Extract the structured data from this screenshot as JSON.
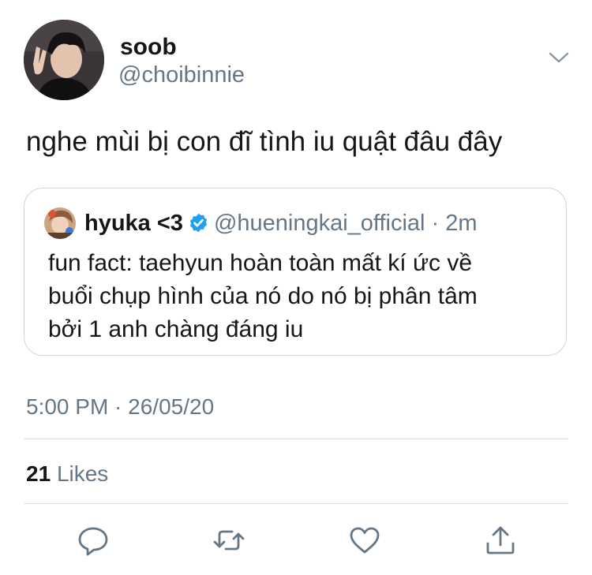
{
  "author": {
    "display_name": "soob",
    "handle": "@choibinnie"
  },
  "tweet": {
    "text": "nghe mùi bị con đĩ tình iu quật đâu đây",
    "timestamp": "5:00 PM · 26/05/20",
    "likes_count": "21",
    "likes_label": "Likes"
  },
  "quoted_tweet": {
    "display_name": "hyuka <3",
    "handle": "@hueningkai_official",
    "separator": " · ",
    "time": "2m",
    "lines": [
      "fun fact: taehyun hoàn toàn mất kí ức về",
      "buổi chụp hình của nó do nó bị phân tâm",
      "bởi 1 anh chàng đáng iu"
    ]
  },
  "icons": {
    "more": "chevron-down-icon",
    "verified": "verified-badge-icon",
    "reply": "reply-icon",
    "retweet": "retweet-icon",
    "like": "heart-icon",
    "share": "share-icon"
  },
  "colors": {
    "text": "#14171a",
    "secondary": "#657786",
    "accent": "#1da1f2",
    "border": "#ccd6dd"
  }
}
